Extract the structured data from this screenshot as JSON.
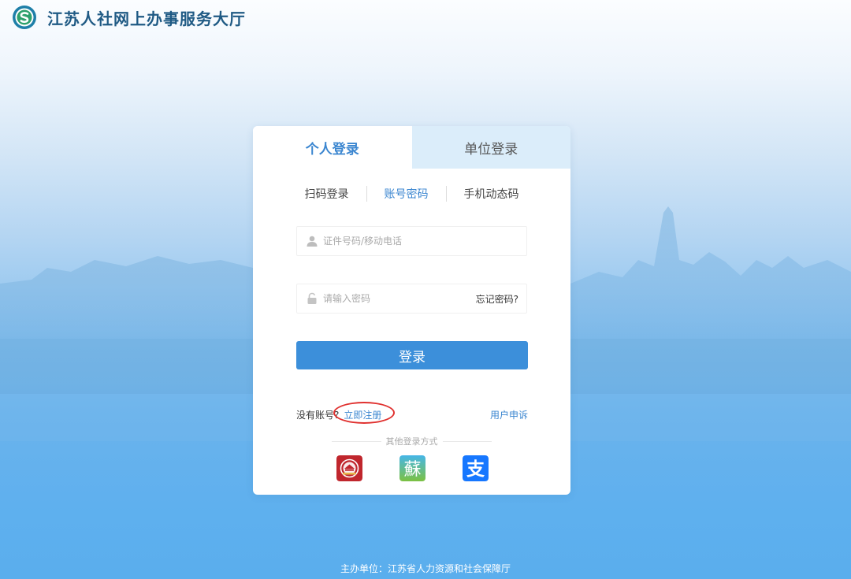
{
  "header": {
    "site_title": "江苏人社网上办事服务大厅",
    "logo_icon": "social-security-logo-icon"
  },
  "login": {
    "tabs": [
      {
        "label": "个人登录",
        "active": true
      },
      {
        "label": "单位登录",
        "active": false
      }
    ],
    "subtabs": [
      {
        "label": "扫码登录",
        "active": false
      },
      {
        "label": "账号密码",
        "active": true
      },
      {
        "label": "手机动态码",
        "active": false
      }
    ],
    "username": {
      "placeholder": "证件号码/移动电话",
      "value": "",
      "icon": "user-icon"
    },
    "password": {
      "placeholder": "请输入密码",
      "value": "",
      "icon": "lock-icon"
    },
    "forgot_label": "忘记密码?",
    "submit_label": "登录",
    "no_account_label": "没有账号?",
    "register_label": "立即注册",
    "complaint_label": "用户申诉",
    "other_methods_label": "其他登录方式",
    "other_methods": [
      {
        "icon": "government-service-app-icon"
      },
      {
        "icon": "su-app-icon",
        "glyph": "蘇"
      },
      {
        "icon": "alipay-icon",
        "glyph": "支"
      }
    ]
  },
  "footer": {
    "sponsor": "主办单位：江苏省人力资源和社会保障厅"
  },
  "colors": {
    "accent": "#3c8fda",
    "title": "#1f5a84",
    "unit_tab_bg": "#dbedfa",
    "highlight": "#e0312f",
    "alipay": "#1677ff",
    "gov_app": "#c0262d"
  }
}
